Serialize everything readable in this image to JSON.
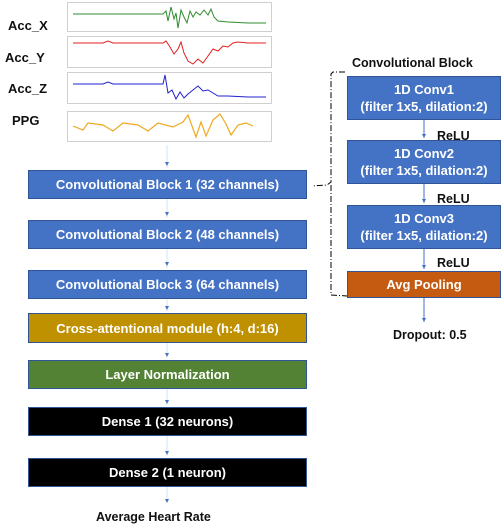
{
  "signals": [
    {
      "label": "Acc_X",
      "color": "#2e8b2e"
    },
    {
      "label": "Acc_Y",
      "color": "#e02020"
    },
    {
      "label": "Acc_Z",
      "color": "#2020d0"
    },
    {
      "label": "PPG",
      "color": "#f0a820"
    }
  ],
  "main_pipeline": [
    {
      "label": "Convolutional Block 1 (32 channels)",
      "color": "#4472c4"
    },
    {
      "label": "Convolutional Block 2 (48 channels)",
      "color": "#4472c4"
    },
    {
      "label": "Convolutional Block 3 (64 channels)",
      "color": "#4472c4"
    },
    {
      "label": "Cross-attentional module (h:4, d:16)",
      "color": "#bf9000"
    },
    {
      "label": "Layer Normalization",
      "color": "#548235"
    },
    {
      "label": "Dense 1 (32 neurons)",
      "color": "#000000"
    },
    {
      "label": "Dense 2 (1 neuron)",
      "color": "#000000"
    }
  ],
  "output_label": "Average Heart Rate",
  "conv_block_detail": {
    "title": "Convolutional Block",
    "layers": [
      {
        "line1": "1D Conv1",
        "line2": "(filter 1x5, dilation:2)"
      },
      {
        "line1": "1D Conv2",
        "line2": "(filter 1x5, dilation:2)"
      },
      {
        "line1": "1D Conv3",
        "line2": "(filter 1x5, dilation:2)"
      }
    ],
    "activations": [
      "ReLU",
      "ReLU",
      "ReLU"
    ],
    "pooling": "Avg Pooling",
    "dropout": "Dropout: 0.5"
  }
}
